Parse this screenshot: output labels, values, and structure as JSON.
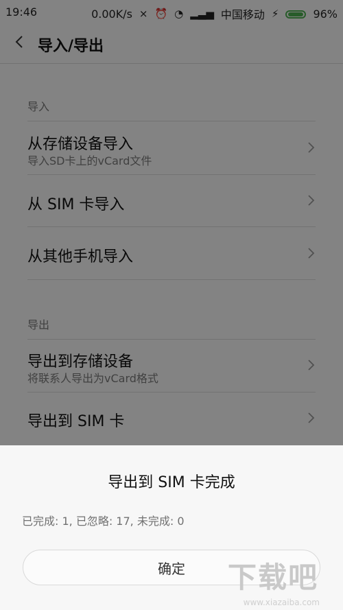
{
  "status": {
    "time": "19:46",
    "speed": "0.00K/s",
    "carrier": "中国移动",
    "battery": "96%",
    "icons": [
      "vibrate-off-icon",
      "alarm-icon",
      "wifi-icon",
      "signal-icon",
      "charging-icon"
    ]
  },
  "header": {
    "title": "导入/导出"
  },
  "sections": {
    "import_label": "导入",
    "export_label": "导出"
  },
  "items": [
    {
      "title": "从存储设备导入",
      "subtitle": "导入SD卡上的vCard文件"
    },
    {
      "title": "从 SIM 卡导入",
      "subtitle": ""
    },
    {
      "title": "从其他手机导入",
      "subtitle": ""
    },
    {
      "title": "导出到存储设备",
      "subtitle": "将联系人导出为vCard格式"
    },
    {
      "title": "导出到 SIM 卡",
      "subtitle": ""
    }
  ],
  "dialog": {
    "title": "导出到 SIM 卡完成",
    "message": "已完成: 1, 已忽略: 17, 未完成: 0",
    "confirm": "确定"
  },
  "watermark": {
    "big": "下载吧",
    "small": "www.xiazaiba.com"
  }
}
